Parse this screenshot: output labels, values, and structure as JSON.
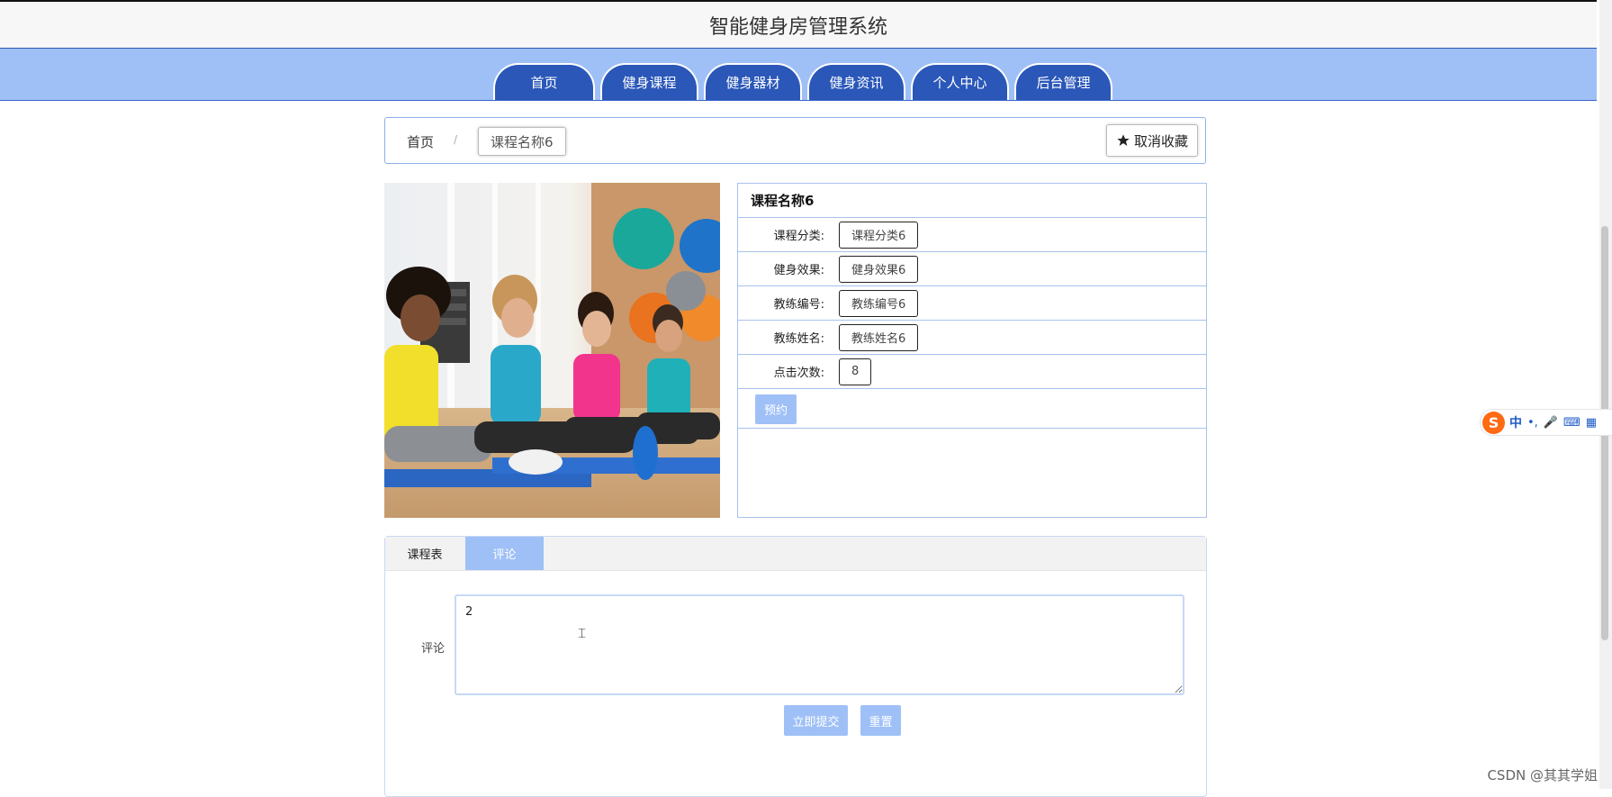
{
  "app": {
    "title": "智能健身房管理系统"
  },
  "nav": {
    "items": [
      {
        "label": "首页"
      },
      {
        "label": "健身课程"
      },
      {
        "label": "健身器材"
      },
      {
        "label": "健身资讯"
      },
      {
        "label": "个人中心"
      },
      {
        "label": "后台管理"
      }
    ]
  },
  "breadcrumb": {
    "home": "首页",
    "separator": "/",
    "current": "课程名称6",
    "favorite_label": "取消收藏",
    "favorite_icon": "star-icon"
  },
  "course": {
    "title": "课程名称6",
    "fields": [
      {
        "label": "课程分类:",
        "value": "课程分类6"
      },
      {
        "label": "健身效果:",
        "value": "健身效果6"
      },
      {
        "label": "教练编号:",
        "value": "教练编号6"
      },
      {
        "label": "教练姓名:",
        "value": "教练姓名6"
      },
      {
        "label": "点击次数:",
        "value": "8"
      }
    ],
    "reserve_label": "预约"
  },
  "tabs": {
    "items": [
      {
        "label": "课程表"
      },
      {
        "label": "评论"
      }
    ],
    "active": "评论"
  },
  "comment_form": {
    "label": "评论",
    "value": "2",
    "submit_label": "立即提交",
    "reset_label": "重置"
  },
  "ime": {
    "logo": "S",
    "mode": "中",
    "punct": "•,",
    "icons": [
      "mic-icon",
      "keyboard-icon",
      "grid-icon"
    ]
  },
  "watermark": "CSDN @其其学姐",
  "colors": {
    "accent": "#2a57b8",
    "nav_background": "#9fc0f7",
    "border": "#a9c1ee"
  }
}
